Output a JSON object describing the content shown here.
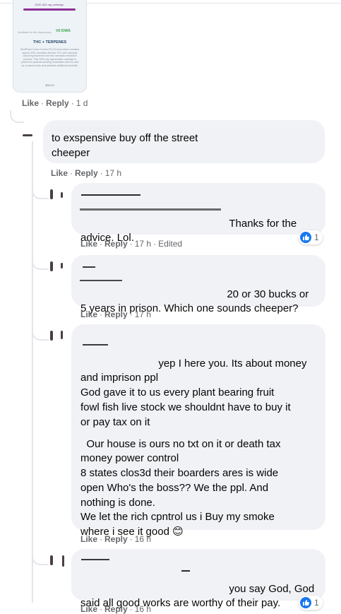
{
  "attachment": {
    "badge": "1025 18G mg cartridge",
    "sub": "Available at the dispensary",
    "logo": "VII IOWA",
    "title": "THC + TERPENES",
    "body": "MedPharm Iowa Comfort PLUS formulation contains approx 80% cannabis-derived THC with naturally occurring terpenes from the cannabis extraction process. This 1000 mg vaporization cartridge is perfect for patients seeking immediate relief as well as a natural taste and potential additional benefits.",
    "price": "$00.00"
  },
  "top_actions": {
    "like": "Like",
    "reply": "Reply",
    "time": "1 d"
  },
  "comments": [
    {
      "text": "to exspensive buy off the street\ncheeper",
      "actions": {
        "like": "Like",
        "reply": "Reply",
        "time": "17 h"
      }
    },
    {
      "text": "Thanks for the\nadvice. Lol.",
      "actions": {
        "like": "Like",
        "reply": "Reply",
        "time": "17 h",
        "edited": "Edited"
      },
      "reaction_count": "1"
    },
    {
      "text": "20 or 30 bucks or\n5 years in prison. Which one sounds cheeper?",
      "actions": {
        "like": "Like",
        "reply": "Reply",
        "time": "17 h"
      }
    },
    {
      "text": "yep I here you. Its about money\nand imprison ppl\nGod gave it to us every plant bearing fruit\nfowl fish live stock we shouldnt have to buy it\nor pay tax on it",
      "text2": "Our house is ours no txt on it or death tax\nmoney power control\n8 states clos3d their boarders ares is wide\nopen Who's the boss?? We the ppl. And\nnothing is done.\nWe let the rich cpntrol us i Buy my smoke\nwhere i see it good",
      "emoji": "😊",
      "actions": {
        "like": "Like",
        "reply": "Reply",
        "time": "16 h"
      }
    },
    {
      "text": "you say God, God\nsaid all good works are worthy of their pay.",
      "actions": {
        "like": "Like",
        "reply": "Reply",
        "time": "16 h"
      },
      "reaction_count": "1"
    }
  ],
  "colors": {
    "bubble": "#f0f2f5",
    "like_blue": "#1877f2",
    "meta": "#65676b"
  }
}
